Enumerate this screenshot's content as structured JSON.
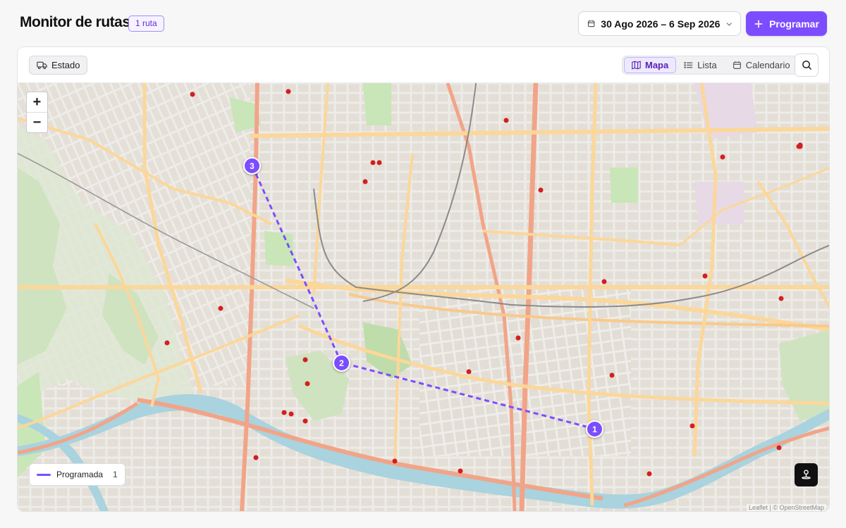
{
  "header": {
    "title": "Monitor de rutas",
    "route_count_badge": "1 ruta",
    "date_range": "30 Ago 2026 – 6 Sep 2026",
    "schedule_button": "Programar"
  },
  "toolbar": {
    "status_filter": "Estado",
    "views": [
      {
        "label": "Mapa",
        "icon": "map-icon",
        "active": true
      },
      {
        "label": "Lista",
        "icon": "list-icon",
        "active": false
      },
      {
        "label": "Calendario",
        "icon": "calendar-icon",
        "active": false
      }
    ]
  },
  "map": {
    "zoom_in": "+",
    "zoom_out": "−",
    "stops": [
      "3",
      "2",
      "1"
    ],
    "legend": {
      "label": "Programada",
      "count": "1"
    },
    "attribution": "Leaflet | © OpenStreetMap"
  },
  "colors": {
    "accent": "#7c4dff",
    "route_line": "#7c4dff",
    "river": "#a9d3de",
    "park": "#c8e6b8",
    "highway": "#f2a488",
    "primary_road": "#fbd79a"
  }
}
